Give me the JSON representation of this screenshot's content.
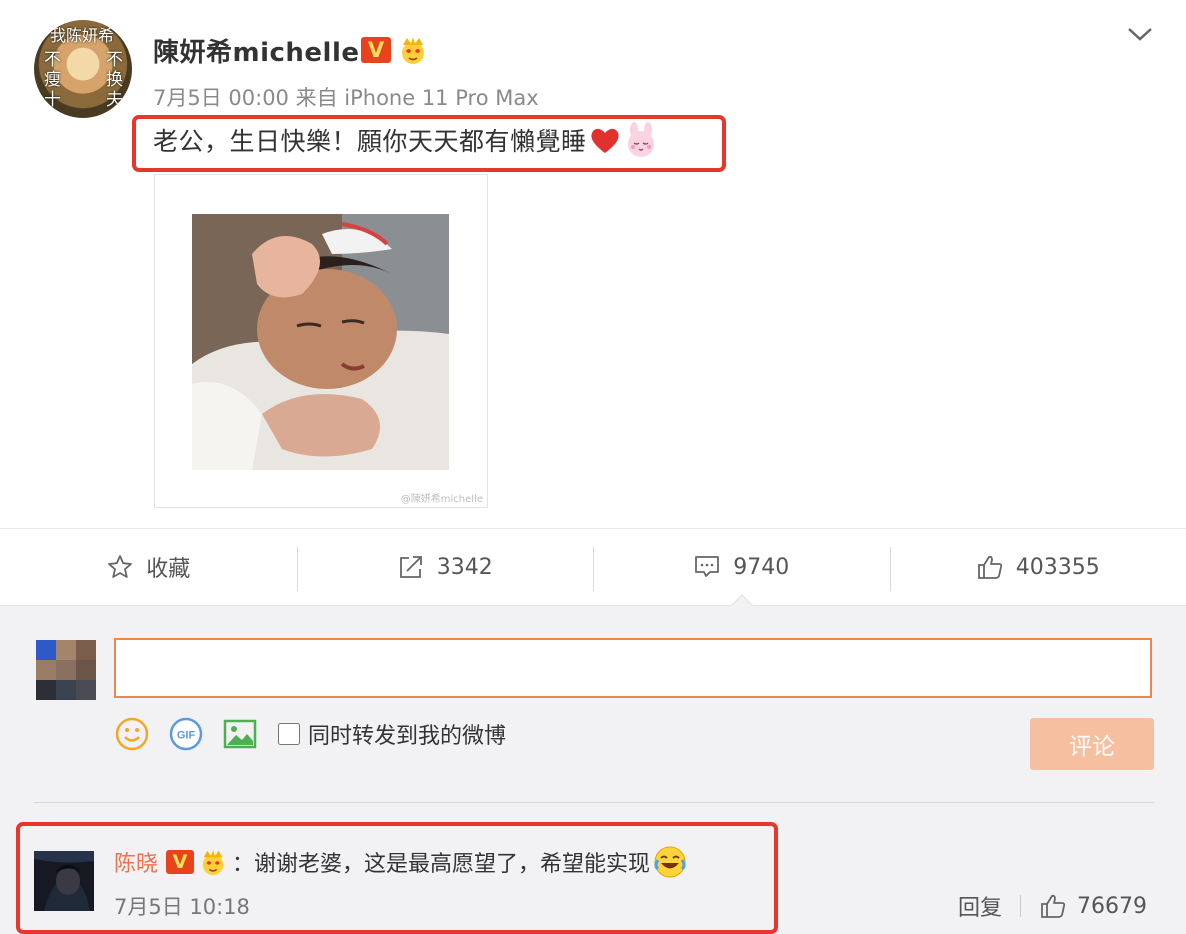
{
  "post": {
    "author": "陳妍希michelle",
    "badge_v": "V",
    "meta": "7月5日 00:00 来自 iPhone 11 Pro Max",
    "text": "老公，生日快樂！願你天天都有懶覺睡",
    "avatar_text": [
      "我陈妍希",
      "不",
      "瘦",
      "十",
      "不",
      "换",
      "夫"
    ],
    "photo_watermark": "@陳妍希michelle"
  },
  "actions": {
    "favorite_label": "收藏",
    "repost_count": "3342",
    "comment_count": "9740",
    "like_count": "403355"
  },
  "composer": {
    "input_value": "",
    "repost_checkbox_label": "同时转发到我的微博",
    "repost_checked": false,
    "submit_label": "评论",
    "gif_label": "GIF"
  },
  "comments": [
    {
      "author": "陈晓",
      "badge_v": "V",
      "text": "：谢谢老婆，这是最高愿望了，希望能实现",
      "time": "7月5日 10:18",
      "reply_label": "回复",
      "like_count": "76679"
    }
  ],
  "colors": {
    "accent": "#eb7350",
    "highlight": "#e8362c",
    "v_badge": "#e8431c",
    "submit_disabled": "#f6c0a0",
    "input_border": "#f0874a"
  }
}
